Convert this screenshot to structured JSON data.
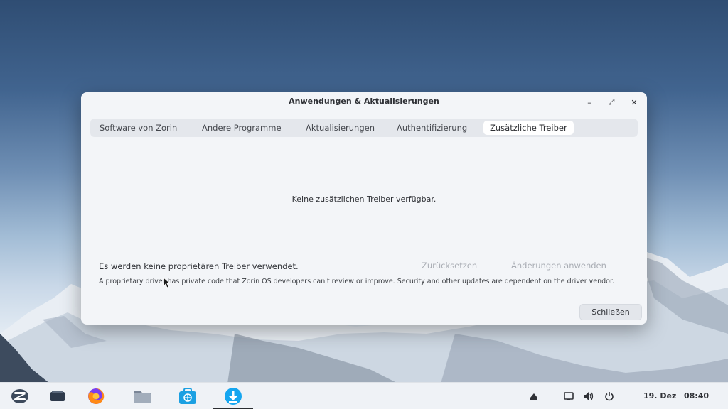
{
  "window": {
    "title": "Anwendungen & Aktualisierungen",
    "controls": {
      "minimize": "–",
      "maximize": "⤢",
      "close": "✕"
    }
  },
  "tabs": [
    {
      "label": "Software von Zorin",
      "active": false
    },
    {
      "label": "Andere Programme",
      "active": false
    },
    {
      "label": "Aktualisierungen",
      "active": false
    },
    {
      "label": "Authentifizierung",
      "active": false
    },
    {
      "label": "Zusätzliche Treiber",
      "active": true
    }
  ],
  "drivers": {
    "empty_message": "Keine zusätzlichen Treiber verfügbar.",
    "status": "Es werden keine proprietären Treiber verwendet.",
    "reset_label": "Zurücksetzen",
    "apply_label": "Änderungen anwenden",
    "info": "A proprietary driver has private code that Zorin OS developers can't review or improve. Security and other updates are dependent on the driver vendor.",
    "close_label": "Schließen"
  },
  "taskbar": {
    "apps": [
      "zorin-menu-icon",
      "workspace-icon",
      "firefox-icon",
      "files-icon",
      "software-store-icon",
      "software-updater-icon"
    ],
    "date": "19. Dez",
    "time": "08:40"
  },
  "colors": {
    "accent": "#15a6f0",
    "disabled_text": "#a9adb4"
  }
}
